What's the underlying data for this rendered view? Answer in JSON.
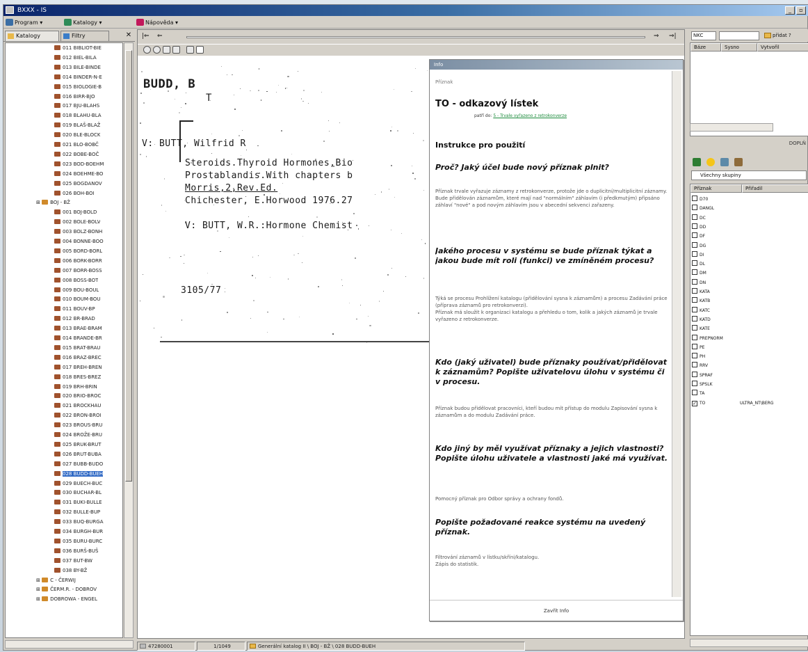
{
  "window": {
    "title": "BXXX - IS"
  },
  "menu": [
    {
      "label": "Program",
      "icon": "program-icon",
      "color": "#3a6ea5"
    },
    {
      "label": "Katalogy",
      "icon": "catalog-icon",
      "color": "#2e8b57"
    },
    {
      "label": "Nápověda",
      "icon": "help-icon",
      "color": "#c2185b"
    }
  ],
  "left_panel": {
    "tabs": [
      "Katalogy",
      "Filtry"
    ],
    "tree": [
      {
        "label": "011 BIBLIOT-BIE",
        "level": 2
      },
      {
        "label": "012 BIEL-BILA",
        "level": 2
      },
      {
        "label": "013 BILE-BINDE",
        "level": 2
      },
      {
        "label": "014 BINDER-N-E",
        "level": 2
      },
      {
        "label": "015 BIOLOGIE-B",
        "level": 2
      },
      {
        "label": "016 BIRR-BJO",
        "level": 2
      },
      {
        "label": "017 BJU-BLAHS",
        "level": 2
      },
      {
        "label": "018 BLAHU-BLA",
        "level": 2
      },
      {
        "label": "019 BLAŠ-BLAŽ",
        "level": 2
      },
      {
        "label": "020 BLE-BLOCK",
        "level": 2
      },
      {
        "label": "021 BLO-BOBČ",
        "level": 2
      },
      {
        "label": "022 BOBE-BOČ",
        "level": 2
      },
      {
        "label": "023 BOD-BOEHM",
        "level": 2
      },
      {
        "label": "024 BOEHME-BO",
        "level": 2
      },
      {
        "label": "025 BOGDANOV",
        "level": 2
      },
      {
        "label": "026 BOH-BOI",
        "level": 2
      },
      {
        "label": "BOJ - BŽ",
        "level": 1
      },
      {
        "label": "001 BOJ-BOLD",
        "level": 2
      },
      {
        "label": "002 BOLE-BOLV",
        "level": 2
      },
      {
        "label": "003 BOLZ-BONH",
        "level": 2
      },
      {
        "label": "004 BONNE-BOO",
        "level": 2
      },
      {
        "label": "005 BORD-BORL",
        "level": 2
      },
      {
        "label": "006 BORK-BORR",
        "level": 2
      },
      {
        "label": "007 BORR-BOSS",
        "level": 2
      },
      {
        "label": "008 BOSS-BOT",
        "level": 2
      },
      {
        "label": "009 BOU-BOUL",
        "level": 2
      },
      {
        "label": "010 BOUM-BOU",
        "level": 2
      },
      {
        "label": "011 BOUV-BP",
        "level": 2
      },
      {
        "label": "012 BR-BRAD",
        "level": 2
      },
      {
        "label": "013 BRAE-BRAM",
        "level": 2
      },
      {
        "label": "014 BRANDE-BR",
        "level": 2
      },
      {
        "label": "015 BRAT-BRAU",
        "level": 2
      },
      {
        "label": "016 BRAZ-BREC",
        "level": 2
      },
      {
        "label": "017 BREH-BREN",
        "level": 2
      },
      {
        "label": "018 BRES-BREZ",
        "level": 2
      },
      {
        "label": "019 BRH-BRIN",
        "level": 2
      },
      {
        "label": "020 BRIO-BROC",
        "level": 2
      },
      {
        "label": "021 BROCKHAU",
        "level": 2
      },
      {
        "label": "022 BRON-BROI",
        "level": 2
      },
      {
        "label": "023 BROUS-BRU",
        "level": 2
      },
      {
        "label": "024 BROŽE-BRU",
        "level": 2
      },
      {
        "label": "025 BRUK-BRUT",
        "level": 2
      },
      {
        "label": "026 BRUT-BUBA",
        "level": 2
      },
      {
        "label": "027 BUBB-BUDO",
        "level": 2
      },
      {
        "label": "028 BUDD-BUEH",
        "level": 2,
        "selected": true
      },
      {
        "label": "029 BUECH-BUC",
        "level": 2
      },
      {
        "label": "030 BUCHAR-BL",
        "level": 2
      },
      {
        "label": "031 BUKI-BULLE",
        "level": 2
      },
      {
        "label": "032 BULLE-BUP",
        "level": 2
      },
      {
        "label": "033 BUQ-BURGA",
        "level": 2
      },
      {
        "label": "034 BURGH-BUR",
        "level": 2
      },
      {
        "label": "035 BURU-BURC",
        "level": 2
      },
      {
        "label": "036 BURŠ-BUŠ",
        "level": 2
      },
      {
        "label": "037 BUT-BW",
        "level": 2
      },
      {
        "label": "038 BY-BŽ",
        "level": 2
      },
      {
        "label": "C - ČERWIJ",
        "level": 1
      },
      {
        "label": "ČERM.R. - DOBROV",
        "level": 1
      },
      {
        "label": "DOBROWA - ENGEL",
        "level": 1
      }
    ]
  },
  "card": {
    "lines": [
      "BUDD, B",
      "T",
      "V:  BUTT, Wilfrid R",
      "Steroids.Thyroid Hormones,Bio",
      "Prostablandis.With chapters b",
      "Morris,2,Rev.Ed.",
      "Chichester, E.Horwood 1976.27",
      "V: BUTT, W.R.:Hormone Chemist",
      "3105/77"
    ]
  },
  "info": {
    "window_title": "Info",
    "header_small": "Příznak",
    "title": "TO - odkazový lístek",
    "sub_prefix": "patří do:",
    "sub_link": "5 - Trvale vyřazeno z retrokonverze",
    "section": "Instrukce pro použití",
    "q1": "Proč? Jaký účel bude nový příznak plnit?",
    "a1": "Příznak trvale vyřazuje záznamy z retrokonverze, protože jde o duplicitní/multiplicitní záznamy. Bude přidělován záznamům, které mají nad \"normálním\" záhlavím (i předkmutým) připsáno záhlaví \"nové\" a pod novým záhlavím jsou v abecední sekvenci zařazeny.",
    "q2": "Jakého procesu v systému se bude příznak týkat a jakou bude mít roli (funkci) ve zmíněném procesu?",
    "a2": "Týká se procesu Prohlížení katalogu (přidělování sysna k záznamům) a procesu Zadávání práce (příprava záznamů pro retrokonverzi).\nPříznak má sloužit k organizaci katalogu a přehledu o tom, kolik a jakých záznamů je trvale vyřazeno z retrokonverze.",
    "q3": "Kdo (jaký uživatel) bude příznaky používat/přidělovat k záznamům? Popište uživatelovu úlohu v systému či v procesu.",
    "a3": "Příznak budou přidělovat pracovníci, kteří budou mít přístup do modulu Zapisování sysna k záznamům a do modulu Zadávání práce.",
    "q4": "Kdo jiný by měl využívat příznaky a jejich vlastnosti? Popište úlohu uživatele a vlastnosti jaké má využívat.",
    "a4": "Pomocný příznak pro Odbor správy a ochrany fondů.",
    "q5": "Popište požadované reakce systému na uvedený příznak.",
    "a5": "Filtrování záznamů v lístku/skříni/katalogu.\nZápis do statistik.",
    "close": "Zavřít Info"
  },
  "right_panel": {
    "combo": "NKC",
    "button": "přidat ?",
    "columns": [
      "Báze",
      "Sysno",
      "Vytvořil"
    ],
    "dopl": "DOPLŇ",
    "group": "Všechny skupiny",
    "flag_cols": [
      "Příznak",
      "Přiřadil"
    ],
    "flags": [
      {
        "code": "D70",
        "checked": false,
        "who": ""
      },
      {
        "code": "DANGL",
        "checked": false,
        "who": ""
      },
      {
        "code": "DC",
        "checked": false,
        "who": ""
      },
      {
        "code": "DD",
        "checked": false,
        "who": ""
      },
      {
        "code": "DF",
        "checked": false,
        "who": ""
      },
      {
        "code": "DG",
        "checked": false,
        "who": ""
      },
      {
        "code": "DI",
        "checked": false,
        "who": ""
      },
      {
        "code": "DL",
        "checked": false,
        "who": ""
      },
      {
        "code": "DM",
        "checked": false,
        "who": ""
      },
      {
        "code": "DN",
        "checked": false,
        "who": ""
      },
      {
        "code": "KATA",
        "checked": false,
        "who": ""
      },
      {
        "code": "KATB",
        "checked": false,
        "who": ""
      },
      {
        "code": "KATC",
        "checked": false,
        "who": ""
      },
      {
        "code": "KATD",
        "checked": false,
        "who": ""
      },
      {
        "code": "KATE",
        "checked": false,
        "who": ""
      },
      {
        "code": "PREPNORM",
        "checked": false,
        "who": ""
      },
      {
        "code": "PE",
        "checked": false,
        "who": ""
      },
      {
        "code": "PH",
        "checked": false,
        "who": ""
      },
      {
        "code": "RRV",
        "checked": false,
        "who": ""
      },
      {
        "code": "SPRAF",
        "checked": false,
        "who": ""
      },
      {
        "code": "SPSLK",
        "checked": false,
        "who": ""
      },
      {
        "code": "TA",
        "checked": false,
        "who": ""
      },
      {
        "code": "TO",
        "checked": true,
        "who": "ULTRA_NT\\BERG"
      }
    ]
  },
  "status": {
    "id": "47280001",
    "pages": "1/1049",
    "path": "Generální katalog II \\ BOJ - BŽ \\ 028 BUDD-BUEH"
  }
}
